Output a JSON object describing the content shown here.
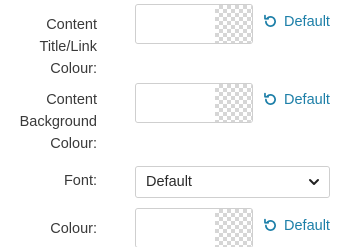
{
  "rows": [
    {
      "label_lines": [
        "Content",
        "Title/Link",
        "Colour:"
      ],
      "colour_value": "",
      "default_label": "Default"
    },
    {
      "label_lines": [
        "Content",
        "Background",
        "Colour:"
      ],
      "colour_value": "",
      "default_label": "Default"
    },
    {
      "label_lines": [
        "Font:"
      ],
      "selected": "Default"
    },
    {
      "label_lines": [
        "Colour:"
      ],
      "colour_value": "",
      "default_label": "Default"
    }
  ],
  "colors": {
    "link": "#1d7fa8",
    "text": "#3a3a3a",
    "border": "#cfcfcf"
  },
  "icons": {
    "reset": "undo-arrow-icon",
    "dropdown": "chevron-down-icon"
  }
}
